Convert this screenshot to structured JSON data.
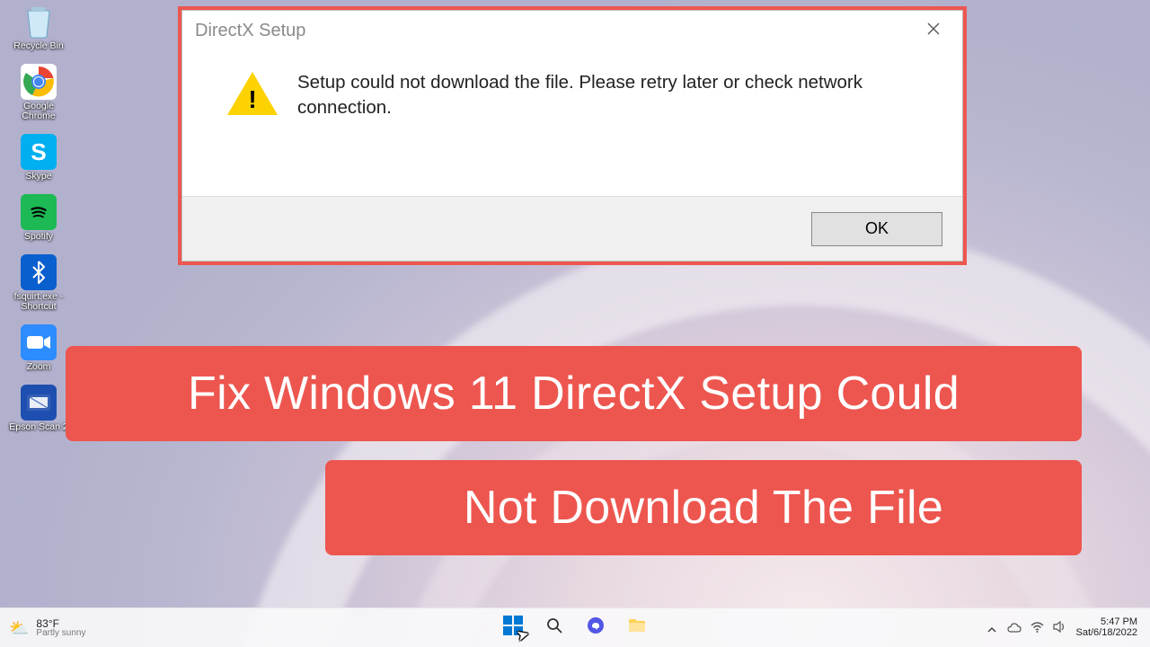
{
  "desktop": {
    "icons": [
      {
        "name": "Recycle Bin"
      },
      {
        "name": "Google Chrome"
      },
      {
        "name": "Skype"
      },
      {
        "name": "Spotify"
      },
      {
        "name": "fsquirt.exe - Shortcut"
      },
      {
        "name": "Zoom"
      },
      {
        "name": "Epson Scan 2"
      }
    ]
  },
  "dialog": {
    "title": "DirectX Setup",
    "message": "Setup could not download the file. Please retry later or check network connection.",
    "ok_label": "OK"
  },
  "banners": {
    "line1": "Fix Windows 11 DirectX Setup Could",
    "line2": "Not Download The File"
  },
  "taskbar": {
    "weather": {
      "temp": "83°F",
      "desc": "Partly sunny"
    },
    "clock": {
      "time": "5:47 PM",
      "date": "Sat/6/18/2022"
    }
  }
}
